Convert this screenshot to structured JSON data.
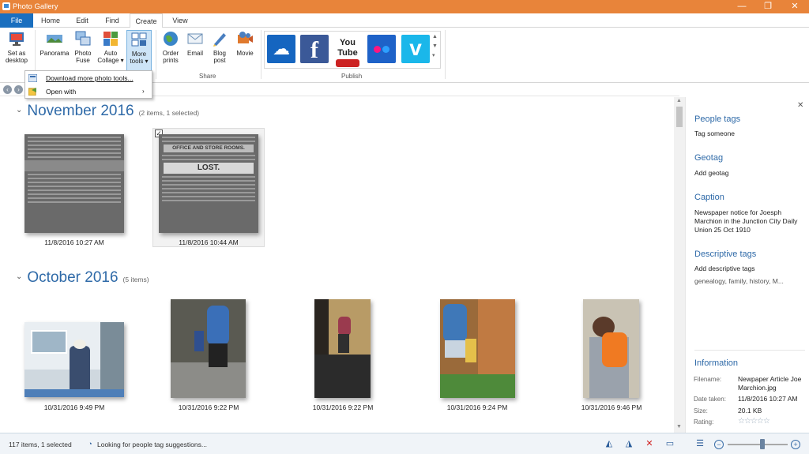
{
  "window": {
    "title": "Photo Gallery",
    "minimize": "—",
    "maximize": "❐",
    "close": "✕"
  },
  "tabs": [
    "File",
    "Home",
    "Edit",
    "Find",
    "Create",
    "View"
  ],
  "ribbon": {
    "buttons": [
      {
        "label1": "Set as",
        "label2": "desktop",
        "icon": "desktop-icon"
      },
      {
        "label1": "Panorama",
        "label2": "",
        "icon": "panorama-icon"
      },
      {
        "label1": "Photo",
        "label2": "Fuse",
        "icon": "photo-fuse-icon"
      },
      {
        "label1": "Auto",
        "label2": "Collage ▾",
        "icon": "collage-icon"
      },
      {
        "label1": "More",
        "label2": "tools ▾",
        "icon": "more-tools-icon"
      },
      {
        "label1": "Order",
        "label2": "prints",
        "icon": "globe-icon"
      },
      {
        "label1": "Email",
        "label2": "",
        "icon": "email-icon"
      },
      {
        "label1": "Blog",
        "label2": "post",
        "icon": "blog-icon"
      },
      {
        "label1": "Movie",
        "label2": "",
        "icon": "movie-icon"
      }
    ],
    "groups": {
      "share": "Share",
      "publish": "Publish"
    },
    "publish": [
      {
        "name": "onedrive",
        "color": "#1565c0",
        "glyph": "☁"
      },
      {
        "name": "facebook",
        "color": "#3b5998",
        "glyph": "f"
      },
      {
        "name": "youtube",
        "color": "#ffffff",
        "glyph": "You Tube"
      },
      {
        "name": "flickr",
        "color": "#1e62c8",
        "glyph": "●●"
      },
      {
        "name": "vimeo",
        "color": "#1ab7ea",
        "glyph": "v"
      }
    ]
  },
  "dropdown": {
    "items": [
      "Download more photo tools...",
      "Open with"
    ]
  },
  "groups": [
    {
      "title": "November 2016",
      "summary": "(2 items, 1 selected)",
      "items": [
        {
          "caption": "11/8/2016 10:27 AM"
        },
        {
          "caption": "11/8/2016 10:44 AM",
          "headline": "LOST.",
          "subhead": "OFFICE AND STORE ROOMS."
        }
      ]
    },
    {
      "title": "October 2016",
      "summary": "(5 items)",
      "items": [
        {
          "caption": "10/31/2016 9:49 PM"
        },
        {
          "caption": "10/31/2016 9:22 PM"
        },
        {
          "caption": "10/31/2016 9:22 PM"
        },
        {
          "caption": "10/31/2016 9:24 PM"
        },
        {
          "caption": "10/31/2016 9:46 PM"
        }
      ]
    }
  ],
  "pane": {
    "people_tags": {
      "title": "People tags",
      "value": "Tag someone"
    },
    "geotag": {
      "title": "Geotag",
      "value": "Add geotag"
    },
    "caption": {
      "title": "Caption",
      "value": "Newspaper notice for Joesph Marchion in the Junction City Daily Union 25 Oct 1910"
    },
    "descriptive": {
      "title": "Descriptive tags",
      "value": "Add descriptive tags",
      "tags": "genealogy, family, history, M..."
    },
    "information": {
      "title": "Information",
      "filename_label": "Filename:",
      "filename": "Newpaper Article Joe Marchion.jpg",
      "date_label": "Date taken:",
      "date": "11/8/2016  10:27 AM",
      "size_label": "Size:",
      "size": "20.1 KB",
      "rating_label": "Rating:",
      "rating": "☆☆☆☆☆"
    }
  },
  "status": {
    "count": "117 items, 1 selected",
    "message": "Looking for people tag suggestions..."
  }
}
